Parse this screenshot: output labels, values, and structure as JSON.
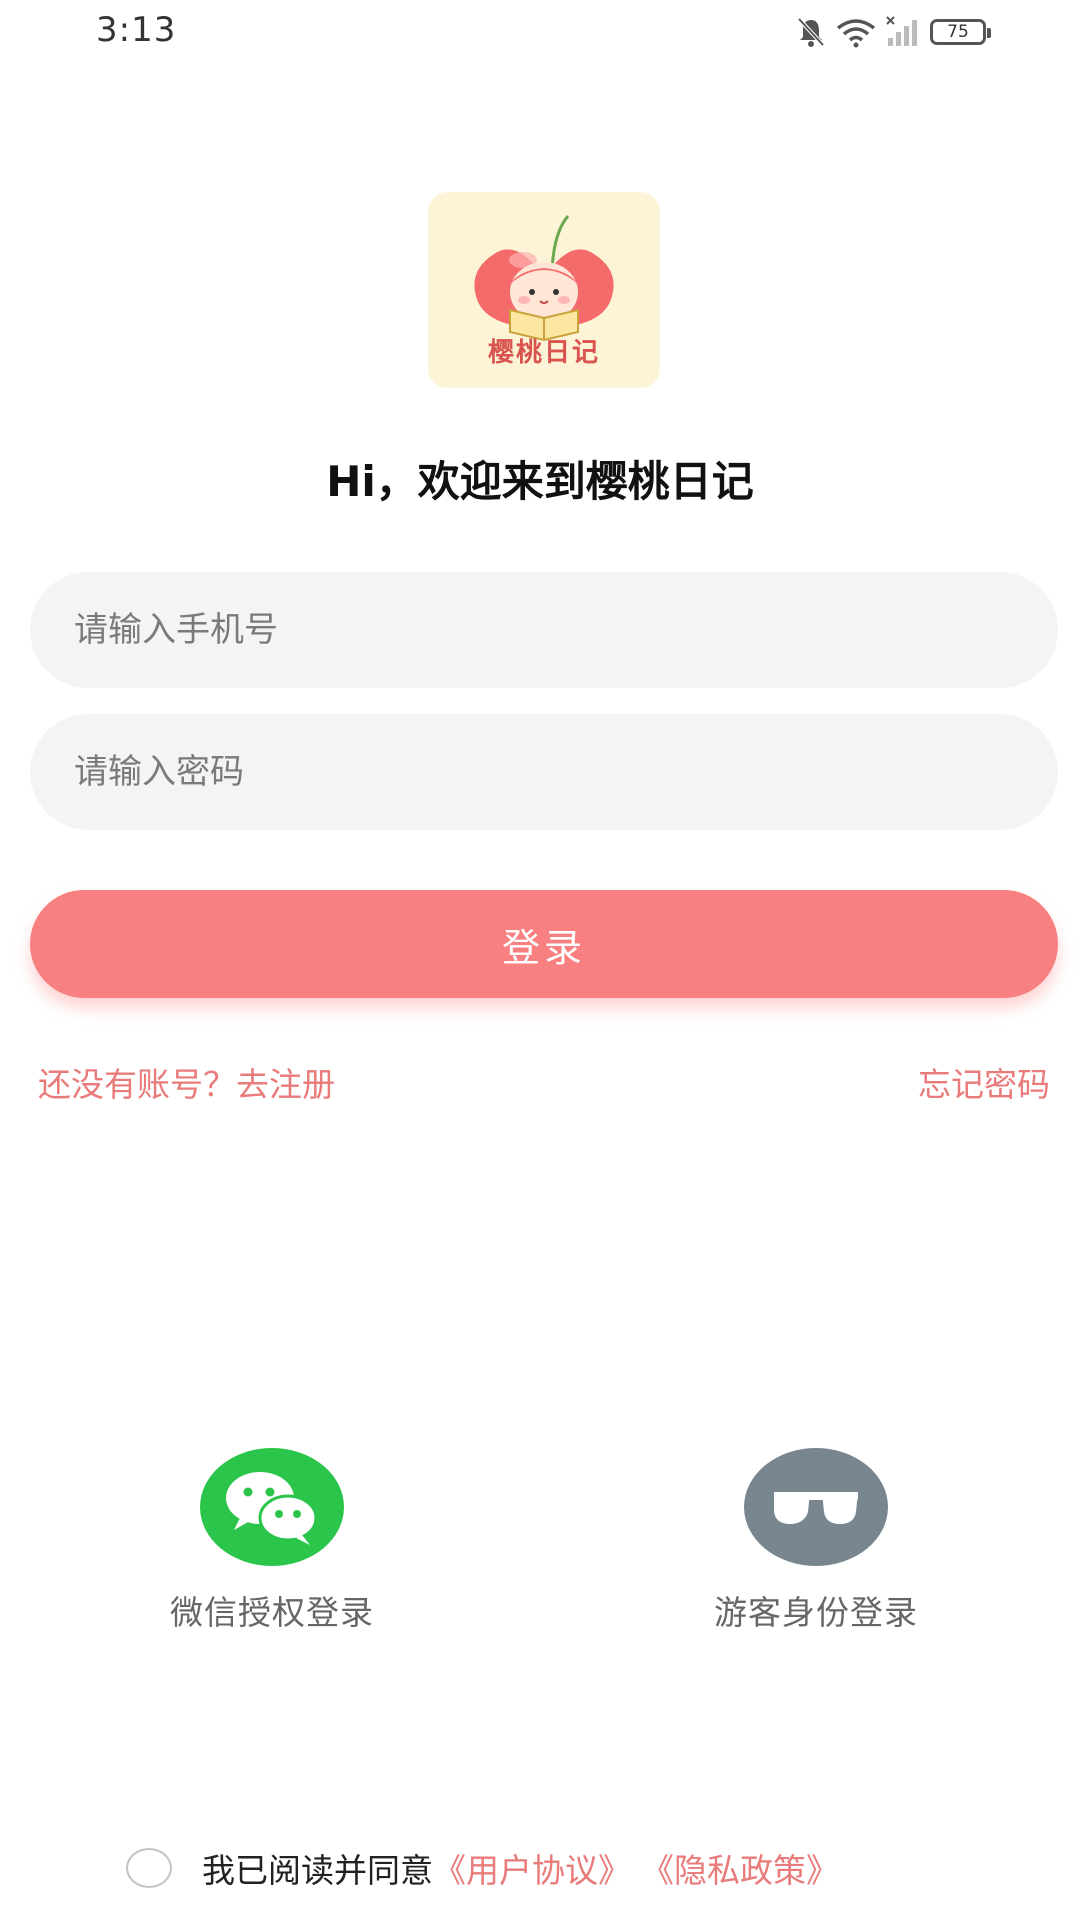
{
  "status_bar": {
    "time": "3:13",
    "battery": "75",
    "icons": [
      "bell-off-icon",
      "wifi-icon",
      "signal-icon",
      "battery-icon"
    ]
  },
  "logo": {
    "text": "樱桃日记"
  },
  "welcome": "Hi，欢迎来到樱桃日记",
  "phone": {
    "placeholder": "请输入手机号",
    "value": ""
  },
  "password": {
    "placeholder": "请输入密码",
    "value": ""
  },
  "login_button": "登录",
  "links": {
    "register": "还没有账号？去注册",
    "forgot": "忘记密码"
  },
  "alt_login": {
    "wechat": {
      "label": "微信授权登录",
      "icon": "wechat-icon"
    },
    "guest": {
      "label": "游客身份登录",
      "icon": "sunglasses-icon"
    }
  },
  "agreement": {
    "prefix": "我已阅读并同意",
    "user_agreement": "《用户协议》",
    "privacy_policy": "《隐私政策》"
  },
  "colors": {
    "accent": "#f98080",
    "link": "#ea7b7b",
    "wechat": "#2cc54b",
    "guest": "#78868f"
  }
}
